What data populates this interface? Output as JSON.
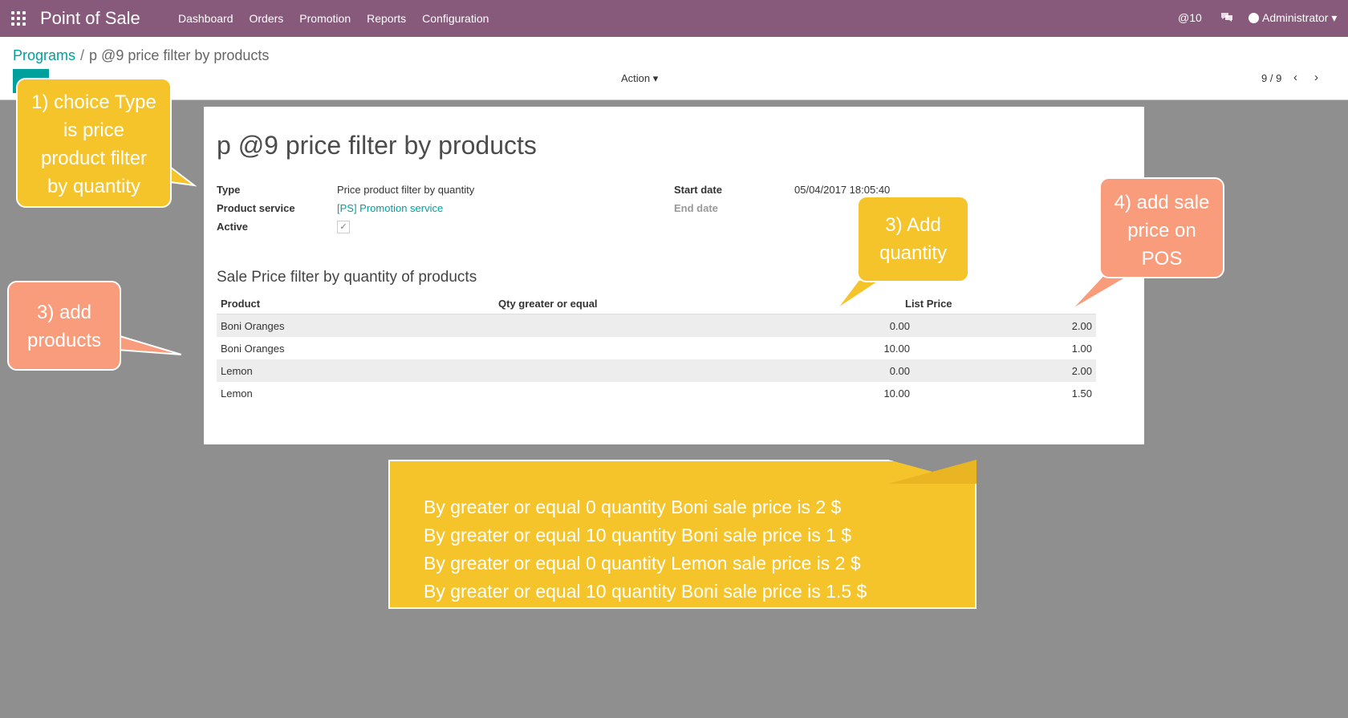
{
  "topbar": {
    "app_title": "Point of Sale",
    "menu": [
      "Dashboard",
      "Orders",
      "Promotion",
      "Reports",
      "Configuration"
    ],
    "mentions": "@10",
    "user": "Administrator ▾"
  },
  "breadcrumb": {
    "parent": "Programs",
    "separator": "/",
    "current": "p @9 price filter by products"
  },
  "control": {
    "action_label": "Action ▾",
    "pager": "9 / 9",
    "prev": "‹",
    "next": "›"
  },
  "form": {
    "title": "p @9 price filter by products",
    "fields": {
      "type_label": "Type",
      "type_value": "Price product filter by quantity",
      "product_service_label": "Product service",
      "product_service_value": "[PS] Promotion service",
      "active_label": "Active",
      "active_check": "✓",
      "start_date_label": "Start date",
      "start_date_value": "05/04/2017 18:05:40",
      "end_date_label": "End date"
    },
    "section_title": "Sale Price filter by quantity of products",
    "columns": [
      "Product",
      "Qty greater or equal",
      "List Price"
    ],
    "rows": [
      {
        "product": "Boni Oranges",
        "qty": "0.00",
        "price": "2.00"
      },
      {
        "product": "Boni Oranges",
        "qty": "10.00",
        "price": "1.00"
      },
      {
        "product": "Lemon",
        "qty": "0.00",
        "price": "2.00"
      },
      {
        "product": "Lemon",
        "qty": "10.00",
        "price": "1.50"
      }
    ]
  },
  "callouts": {
    "type": [
      "1) choice Type",
      "is price",
      "product filter",
      "by quantity"
    ],
    "products": [
      "3) add",
      "products"
    ],
    "quantity": [
      "3) Add",
      "quantity"
    ],
    "sale_price": [
      "4) add sale",
      "price on",
      "POS"
    ]
  },
  "note": {
    "lines": [
      "By greater or equal 0 quantity Boni sale price is 2 $",
      "By greater or equal 10 quantity Boni sale price is 1 $",
      "By greater or equal 0 quantity Lemon sale price is 2 $",
      "By greater or equal 10 quantity Boni sale price is 1.5 $"
    ]
  },
  "colors": {
    "topbar": "#875a7b",
    "accent": "#00a09d",
    "callout_yellow": "#f5c42a",
    "callout_salmon": "#f89c7c"
  }
}
